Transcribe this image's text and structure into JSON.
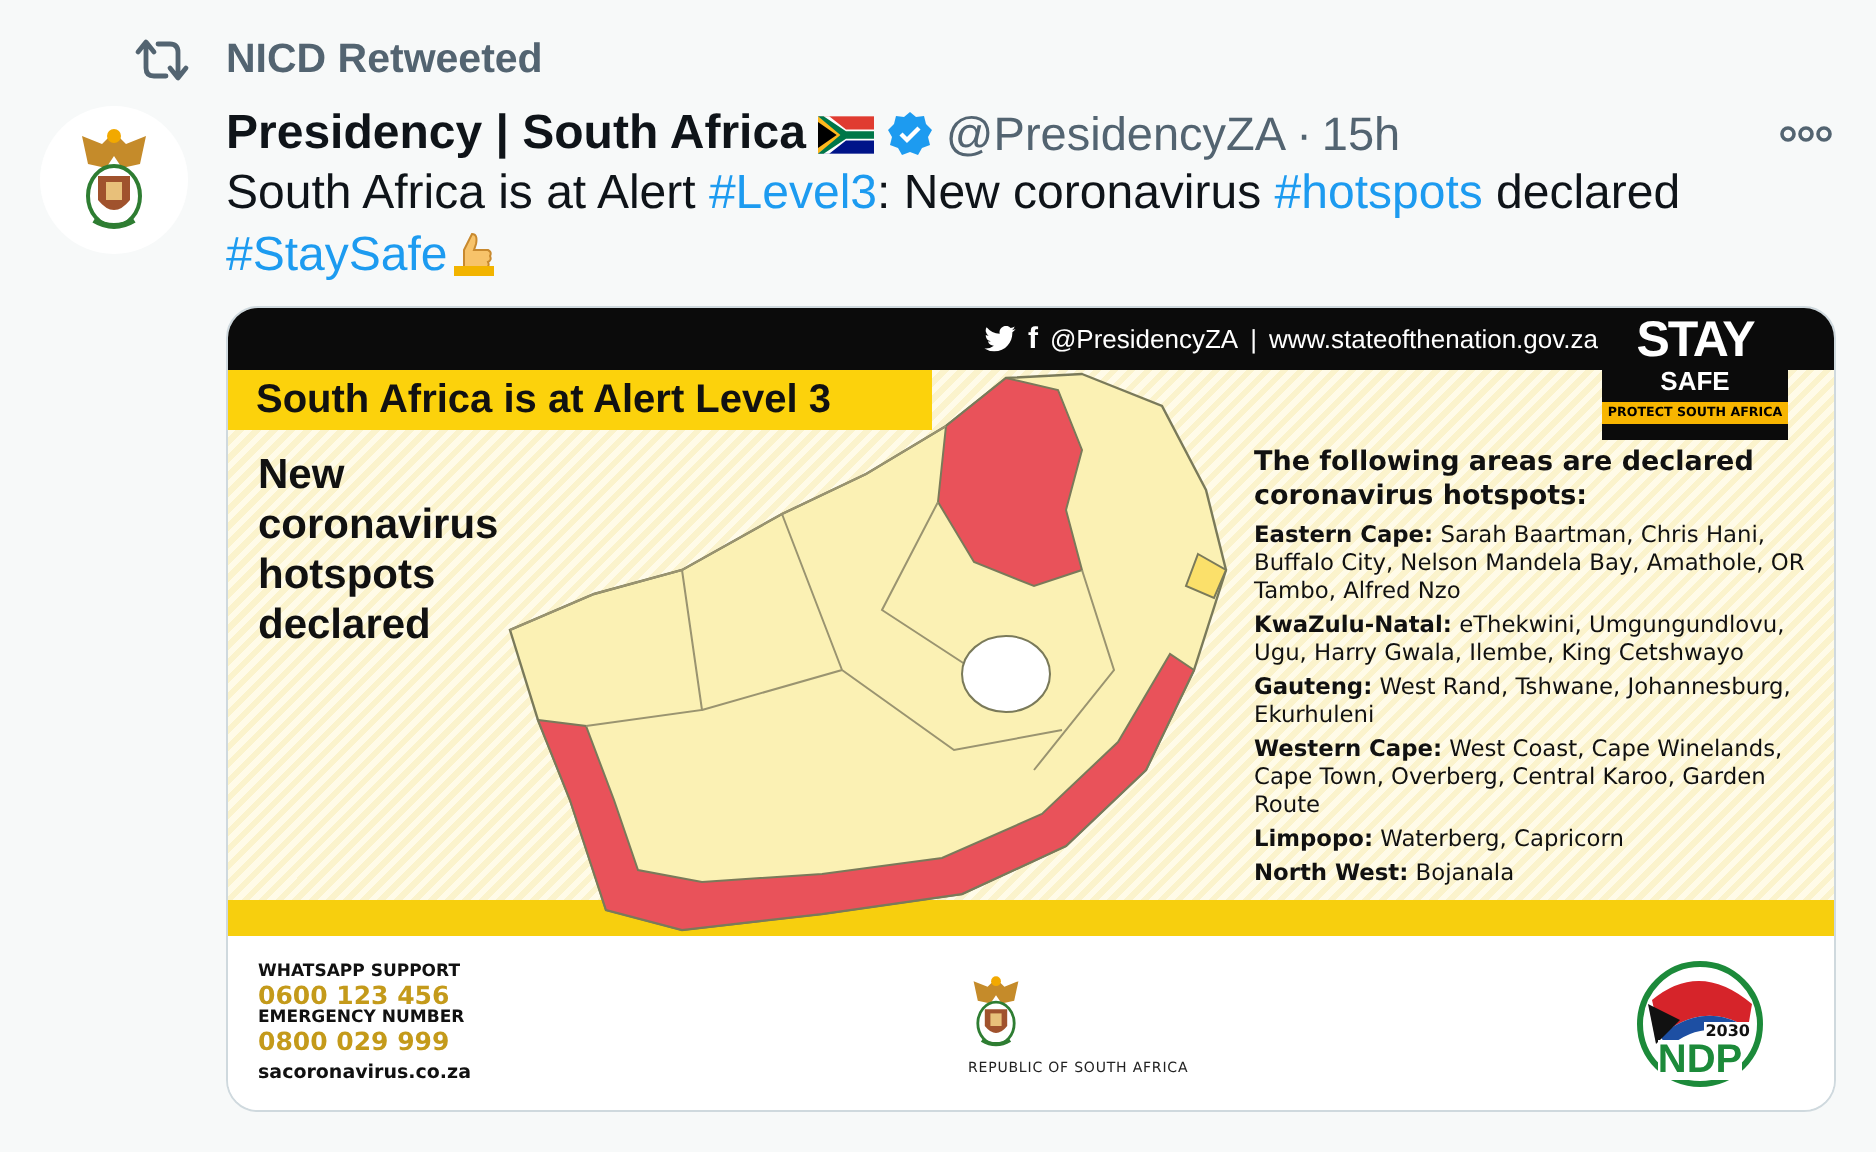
{
  "retweet": {
    "label": "NICD Retweeted"
  },
  "tweet": {
    "author": "Presidency | South Africa",
    "verified": true,
    "handle": "@PresidencyZA",
    "separator": "·",
    "time": "15h",
    "text_lines": [
      [
        {
          "kind": "text",
          "text": "South Africa is at Alert "
        },
        {
          "kind": "hashtag",
          "text": "#Level3"
        },
        {
          "kind": "text",
          "text": ": New coronavirus "
        },
        {
          "kind": "hashtag",
          "text": "#hotspots"
        },
        {
          "kind": "text",
          "text": " declared"
        }
      ],
      [
        {
          "kind": "hashtag",
          "text": "#StaySafe"
        }
      ]
    ]
  },
  "graphic": {
    "handle": "@PresidencyZA",
    "facebook_glyph": "f",
    "divider": "|",
    "website": "www.stateofthenation.gov.za",
    "badge": {
      "top": "STAY",
      "bottom": "SAFE",
      "tagline": "PROTECT SOUTH AFRICA"
    },
    "title": "South Africa is at Alert Level 3",
    "subtitle": "New coronavirus hotspots declared",
    "list_heading": "The following areas are declared coronavirus hotspots:",
    "regions": [
      "**Eastern Cape:** Sarah Baartman, Chris Hani, Buffalo City, Nelson Mandela Bay, Amathole, OR Tambo, Alfred Nzo",
      "**KwaZulu-Natal:** eThekwini, Umgungundlovu, Ugu, Harry Gwala, Ilembe, King Cetshwayo",
      "**Gauteng:** West Rand, Tshwane, Johannesburg, Ekurhuleni",
      "**Western Cape:** West Coast, Cape Winelands, Cape Town, Overberg, Central Karoo, Garden Route",
      "**Limpopo:** Waterberg, Capricorn",
      "**North West:** Bojanala"
    ],
    "contacts": [
      {
        "label": "WHATSAPP SUPPORT",
        "number": "0600 123 456"
      },
      {
        "label": "EMERGENCY NUMBER",
        "number": "0800 029 999"
      }
    ],
    "footer_website": "sacoronavirus.co.za",
    "emblem_caption": "REPUBLIC OF SOUTH AFRICA",
    "ndp": {
      "year": "2030",
      "name": "NDP"
    }
  }
}
